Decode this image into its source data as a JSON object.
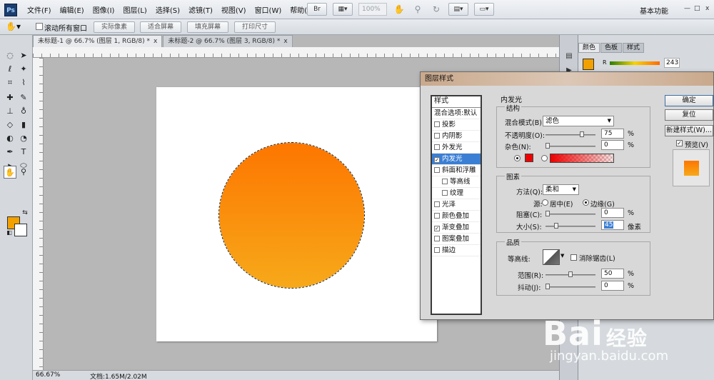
{
  "app": {
    "logo": "Ps",
    "menus": [
      "文件(F)",
      "编辑(E)",
      "图像(I)",
      "图层(L)",
      "选择(S)",
      "滤镜(T)",
      "视图(V)",
      "窗口(W)",
      "帮助(H)"
    ],
    "zoom": "100%",
    "workspace": "基本功能",
    "window_controls": [
      "—",
      "□",
      "x"
    ]
  },
  "options_bar": {
    "scroll_all_label": "滚动所有窗口",
    "buttons": [
      "实际像素",
      "适合屏幕",
      "填充屏幕",
      "打印尺寸"
    ]
  },
  "doc_tabs": [
    {
      "label": "未标题-1 @ 66.7% (图层 1, RGB/8) *",
      "close": "x"
    },
    {
      "label": "未标题-2 @ 66.7% (图层 3, RGB/8) *",
      "close": "x"
    }
  ],
  "colors": {
    "foreground": "#f2a100",
    "background": "#ffffff",
    "circle_top": "#fd7600",
    "circle_bottom": "#f7a91a"
  },
  "status": {
    "zoom": "66.67%",
    "doc": "文档:1.65M/2.02M"
  },
  "right_panel": {
    "tabs": [
      "颜色",
      "色板",
      "样式"
    ],
    "channel": "R",
    "value": "243"
  },
  "dialog": {
    "title": "图层样式",
    "style_list_header": "样式",
    "blend_default": "混合选项:默认",
    "items": [
      {
        "label": "投影",
        "checked": false,
        "sub": false,
        "active": false
      },
      {
        "label": "内阴影",
        "checked": false,
        "sub": false,
        "active": false
      },
      {
        "label": "外发光",
        "checked": false,
        "sub": false,
        "active": false
      },
      {
        "label": "内发光",
        "checked": true,
        "sub": false,
        "active": true
      },
      {
        "label": "斜面和浮雕",
        "checked": false,
        "sub": false,
        "active": false
      },
      {
        "label": "等高线",
        "checked": false,
        "sub": true,
        "active": false
      },
      {
        "label": "纹理",
        "checked": false,
        "sub": true,
        "active": false
      },
      {
        "label": "光泽",
        "checked": false,
        "sub": false,
        "active": false
      },
      {
        "label": "颜色叠加",
        "checked": false,
        "sub": false,
        "active": false
      },
      {
        "label": "渐变叠加",
        "checked": true,
        "sub": false,
        "active": false
      },
      {
        "label": "图案叠加",
        "checked": false,
        "sub": false,
        "active": false
      },
      {
        "label": "描边",
        "checked": false,
        "sub": false,
        "active": false
      }
    ],
    "section_title": "内发光",
    "structure": {
      "title": "结构",
      "blend_mode_label": "混合模式(B):",
      "blend_mode_value": "滤色",
      "opacity_label": "不透明度(O):",
      "opacity_value": "75",
      "opacity": 75,
      "noise_label": "杂色(N):",
      "noise_value": "0",
      "noise": 0,
      "glow_color": "#ee0000",
      "unit": "%"
    },
    "elements": {
      "title": "图素",
      "method_label": "方法(Q):",
      "method_value": "柔和",
      "source_label": "源:",
      "center_label": "居中(E)",
      "edge_label": "边缘(G)",
      "choke_label": "阻塞(C):",
      "choke_value": "0",
      "choke": 0,
      "size_label": "大小(S):",
      "size_value": "45",
      "size_unit": "像素",
      "size_fraction": 0.18,
      "unit": "%"
    },
    "quality": {
      "title": "品质",
      "contour_label": "等高线:",
      "antialias_label": "消除锯齿(L)",
      "range_label": "范围(R):",
      "range_value": "50",
      "range": 50,
      "jitter_label": "抖动(J):",
      "jitter_value": "0",
      "jitter": 0,
      "unit": "%"
    },
    "buttons": {
      "ok": "确定",
      "reset": "复位",
      "new_style": "新建样式(W)...",
      "preview": "预览(V)"
    }
  },
  "watermark": {
    "brand": "Bai",
    "brand2": "经验",
    "site": "jingyan.baidu.com"
  }
}
